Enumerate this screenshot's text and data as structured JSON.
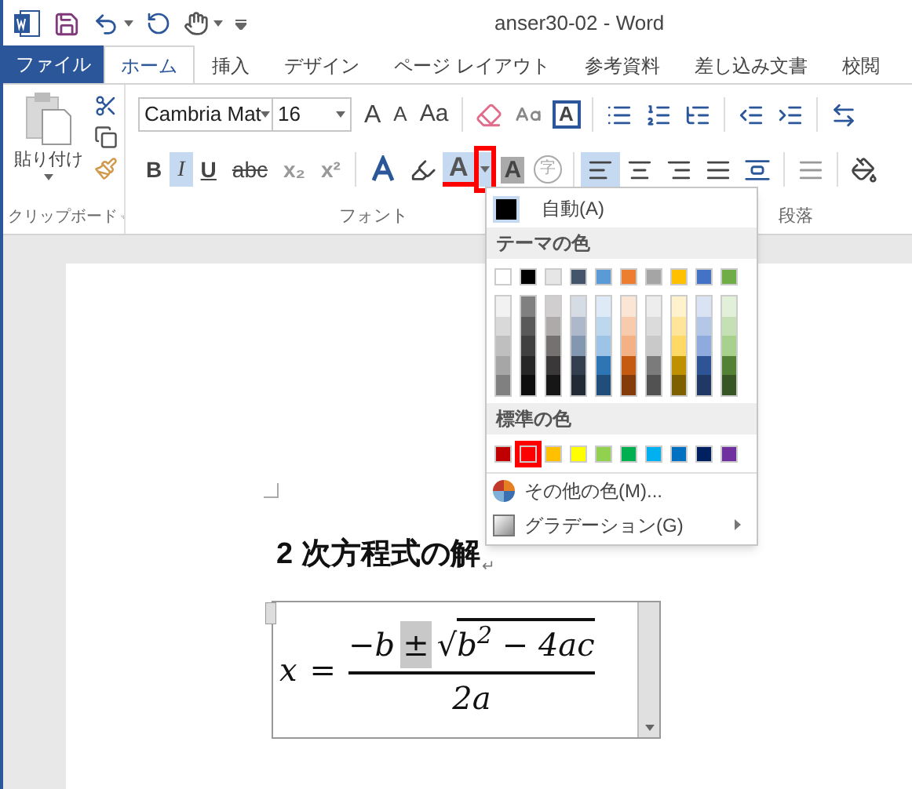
{
  "window": {
    "title": "anser30-02 - Word"
  },
  "tabs": [
    {
      "label": "ファイル",
      "kind": "file",
      "selected": false
    },
    {
      "label": "ホーム",
      "kind": "tab",
      "selected": true
    },
    {
      "label": "挿入",
      "kind": "tab",
      "selected": false
    },
    {
      "label": "デザイン",
      "kind": "tab",
      "selected": false
    },
    {
      "label": "ページ レイアウト",
      "kind": "tab",
      "selected": false
    },
    {
      "label": "参考資料",
      "kind": "tab",
      "selected": false
    },
    {
      "label": "差し込み文書",
      "kind": "tab",
      "selected": false
    },
    {
      "label": "校閲",
      "kind": "tab",
      "selected": false
    }
  ],
  "ribbon": {
    "paste_label": "貼り付け",
    "font_name": "Cambria Mat",
    "font_size": "16",
    "grow_font": "A",
    "shrink_font": "A",
    "change_case": "Aa",
    "character_border": "A",
    "format_buttons": [
      {
        "label": "B",
        "selected": false
      },
      {
        "label": "I",
        "selected": true
      },
      {
        "label": "U",
        "selected": false
      },
      {
        "label": "abc",
        "selected": false
      },
      {
        "label": "x₂",
        "selected": false
      },
      {
        "label": "x²",
        "selected": false
      }
    ],
    "font_color": {
      "label": "A",
      "open": true
    },
    "character_shading": "A",
    "enclose_character": "字",
    "alignment": [
      {
        "selected": true
      },
      {
        "selected": false
      },
      {
        "selected": false
      },
      {
        "selected": false
      },
      {
        "selected": false
      }
    ],
    "groups": [
      "クリップボード",
      "フォント",
      "段落"
    ]
  },
  "color_menu": {
    "automatic": "自動(A)",
    "theme_header": "テーマの色",
    "theme_colors": [
      {
        "color": "#ffffff",
        "shades": [
          {
            "color": "#f2f2f2"
          },
          {
            "color": "#d9d9d9"
          },
          {
            "color": "#bfbfbf"
          },
          {
            "color": "#a6a6a6"
          },
          {
            "color": "#808080"
          }
        ]
      },
      {
        "color": "#000000",
        "shades": [
          {
            "color": "#808080"
          },
          {
            "color": "#595959"
          },
          {
            "color": "#404040"
          },
          {
            "color": "#262626"
          },
          {
            "color": "#0d0d0d"
          }
        ]
      },
      {
        "color": "#e7e6e6",
        "shades": [
          {
            "color": "#d0cece"
          },
          {
            "color": "#aeaaaa"
          },
          {
            "color": "#757171"
          },
          {
            "color": "#3a3838"
          },
          {
            "color": "#171616"
          }
        ]
      },
      {
        "color": "#44546a",
        "shades": [
          {
            "color": "#d6dce4"
          },
          {
            "color": "#adb9ca"
          },
          {
            "color": "#8497b0"
          },
          {
            "color": "#333f4f"
          },
          {
            "color": "#222a35"
          }
        ]
      },
      {
        "color": "#5b9bd5",
        "shades": [
          {
            "color": "#deebf6"
          },
          {
            "color": "#bdd7ee"
          },
          {
            "color": "#9dc3e6"
          },
          {
            "color": "#2e75b5"
          },
          {
            "color": "#1e4e79"
          }
        ]
      },
      {
        "color": "#ed7d31",
        "shades": [
          {
            "color": "#fbe5d5"
          },
          {
            "color": "#f7cbac"
          },
          {
            "color": "#f4b183"
          },
          {
            "color": "#c55a11"
          },
          {
            "color": "#843c0b"
          }
        ]
      },
      {
        "color": "#a5a5a5",
        "shades": [
          {
            "color": "#ededed"
          },
          {
            "color": "#dbdbdb"
          },
          {
            "color": "#c9c9c9"
          },
          {
            "color": "#7b7b7b"
          },
          {
            "color": "#525252"
          }
        ]
      },
      {
        "color": "#ffc000",
        "shades": [
          {
            "color": "#fff2cc"
          },
          {
            "color": "#ffe599"
          },
          {
            "color": "#ffd966"
          },
          {
            "color": "#bf9000"
          },
          {
            "color": "#7f6000"
          }
        ]
      },
      {
        "color": "#4472c4",
        "shades": [
          {
            "color": "#dae3f3"
          },
          {
            "color": "#b4c7e7"
          },
          {
            "color": "#8faadc"
          },
          {
            "color": "#2f5496"
          },
          {
            "color": "#1f3864"
          }
        ]
      },
      {
        "color": "#70ad47",
        "shades": [
          {
            "color": "#e2f0d9"
          },
          {
            "color": "#c5e0b4"
          },
          {
            "color": "#a9d18e"
          },
          {
            "color": "#538135"
          },
          {
            "color": "#375623"
          }
        ]
      }
    ],
    "standard_header": "標準の色",
    "standard_colors": [
      {
        "color": "#c00000",
        "selected": false
      },
      {
        "color": "#ff0000",
        "selected": true
      },
      {
        "color": "#ffc000",
        "selected": false
      },
      {
        "color": "#ffff00",
        "selected": false
      },
      {
        "color": "#92d050",
        "selected": false
      },
      {
        "color": "#00b050",
        "selected": false
      },
      {
        "color": "#00b0f0",
        "selected": false
      },
      {
        "color": "#0070c0",
        "selected": false
      },
      {
        "color": "#002060",
        "selected": false
      },
      {
        "color": "#7030a0",
        "selected": false
      }
    ],
    "more_colors": "その他の色(M)...",
    "gradient": "グラデーション(G)"
  },
  "document": {
    "heading": "2 次方程式の解",
    "paragraph_mark": "↵",
    "equation": {
      "lhs": "x",
      "equals": "=",
      "numerator_left": "−b",
      "plus_minus": "±",
      "radical": "√",
      "radicand": "b$^{2}$ − 4ac",
      "denominator": "2a",
      "plus_minus_selected": true
    }
  }
}
